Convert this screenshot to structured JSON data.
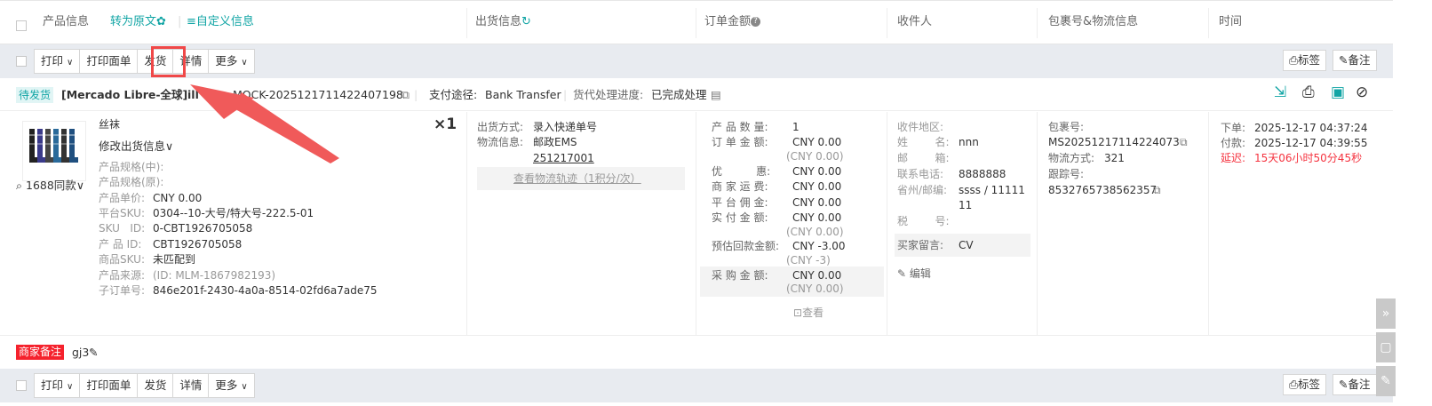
{
  "header": {
    "product_info": "产品信息",
    "convert_original": "转为原文",
    "custom_info": "自定义信息",
    "ship_info": "出货信息",
    "order_amount": "订单金额",
    "recipient": "收件人",
    "package_logistics": "包裹号&物流信息",
    "time": "时间"
  },
  "toolbar": {
    "print": "打印",
    "print_label": "打印面单",
    "ship": "发货",
    "detail": "详情",
    "more": "更多",
    "tag": "标签",
    "remark": "备注"
  },
  "order": {
    "status": "待发货",
    "platform": "[Mercado Libre-全球]",
    "platform_suffix": "ill",
    "order_no": "MOCK-2025121711422407198",
    "payment_label": "支付途径:",
    "payment_value": "Bank Transfer",
    "progress_label": "货代处理进度:",
    "progress_value": "已完成处理"
  },
  "product": {
    "name": "丝袜",
    "quantity": "×1",
    "edit_ship": "修改出货信息",
    "same_style": "1688同款",
    "spec_cn": "产品规格(中):",
    "spec_orig": "产品规格(原):",
    "unit_price_label": "产品单价:",
    "unit_price": "CNY 0.00",
    "platform_sku_label": "平台SKU:",
    "platform_sku": "0304--10-大号/特大号-222.5-01",
    "sku_id_label": "SKU   ID:",
    "sku_id": "0-CBT1926705058",
    "product_id_label": "产 品 ID:",
    "product_id": "CBT1926705058",
    "goods_sku_label": "商品SKU:",
    "goods_sku": "未匹配到",
    "source_label": "产品来源:",
    "source": "(ID: MLM-1867982193)",
    "sub_order_label": "子订单号:",
    "sub_order": "846e201f-2430-4a0a-8514-02fd6a7ade75"
  },
  "shipping": {
    "method_label": "出货方式:",
    "method": "录入快递单号",
    "logistics_label": "物流信息:",
    "carrier": "邮政EMS",
    "tracking": "251217001",
    "view_track": "查看物流轨迹（1积分/次）"
  },
  "amounts": {
    "qty_label": "产 品 数 量:",
    "qty": "1",
    "order_amt_label": "订 单 金 额:",
    "order_amt": "CNY 0.00",
    "order_amt_sub": "(CNY 0.00)",
    "discount_label": "优          惠:",
    "discount": "CNY 0.00",
    "shipping_label": "商 家 运 费:",
    "shipping": "CNY 0.00",
    "commission_label": "平 台 佣 金:",
    "commission": "CNY 0.00",
    "paid_label": "实 付 金 额:",
    "paid": "CNY 0.00",
    "paid_sub": "(CNY 0.00)",
    "est_label": "预估回款金额:",
    "est": "CNY -3.00",
    "est_sub": "(CNY -3)",
    "purchase_label": "采 购 金 额:",
    "purchase": "CNY 0.00",
    "purchase_sub": "(CNY 0.00)",
    "view": "查看"
  },
  "recipient": {
    "region_label": "收件地区:",
    "name_label": "姓        名:",
    "name": "nnn",
    "email_label": "邮        箱:",
    "phone_label": "联系电话:",
    "phone": "8888888",
    "state_label": "省州/邮编:",
    "state": "ssss / 11111",
    "state_cont": "11",
    "tax_label": "税        号:",
    "buyer_msg_label": "买家留言:",
    "buyer_msg": "CV",
    "edit": "编辑"
  },
  "package": {
    "pkg_label": "包裹号:",
    "pkg": "MS20251217114224073",
    "method_label": "物流方式:",
    "method": "321",
    "track_label": "跟踪号:",
    "track": "8532765738562357"
  },
  "times": {
    "order_label": "下单:",
    "order": "2025-12-17 04:37:24",
    "pay_label": "付款:",
    "pay": "2025-12-17 04:39:55",
    "delay_label": "延迟:",
    "delay": "15天06小时50分45秒"
  },
  "merchant_note": {
    "label": "商家备注",
    "value": "gj3"
  },
  "colors": {
    "accent": "#12a5a5",
    "highlight_red": "#f04848",
    "arrow_red": "#f05a5a",
    "toolbar_bg": "#e8ebf0"
  }
}
